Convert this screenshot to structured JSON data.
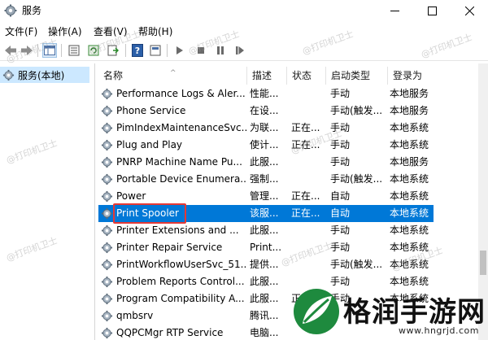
{
  "window": {
    "title": "服务",
    "icon": "gear-icon"
  },
  "menu": [
    {
      "label": "文件(F)"
    },
    {
      "label": "操作(A)"
    },
    {
      "label": "查看(V)"
    },
    {
      "label": "帮助(H)"
    }
  ],
  "tree": {
    "selected_label": "服务(本地)"
  },
  "columns": {
    "name": "名称",
    "desc": "描述",
    "status": "状态",
    "startup": "启动类型",
    "logon": "登录为"
  },
  "services": [
    {
      "name": "Performance Logs & Aler...",
      "desc": "性能...",
      "status": "",
      "startup": "手动",
      "logon": "本地服务"
    },
    {
      "name": "Phone Service",
      "desc": "在设...",
      "status": "",
      "startup": "手动(触发...",
      "logon": "本地服务"
    },
    {
      "name": "PimIndexMaintenanceSvc...",
      "desc": "为联...",
      "status": "正在...",
      "startup": "手动",
      "logon": "本地系统"
    },
    {
      "name": "Plug and Play",
      "desc": "使计...",
      "status": "正在...",
      "startup": "手动",
      "logon": "本地系统"
    },
    {
      "name": "PNRP Machine Name Pu...",
      "desc": "此服...",
      "status": "",
      "startup": "手动",
      "logon": "本地服务"
    },
    {
      "name": "Portable Device Enumera...",
      "desc": "强制...",
      "status": "",
      "startup": "手动(触发...",
      "logon": "本地系统"
    },
    {
      "name": "Power",
      "desc": "管理...",
      "status": "正在...",
      "startup": "自动",
      "logon": "本地系统"
    },
    {
      "name": "Print Spooler",
      "desc": "该服...",
      "status": "正在...",
      "startup": "自动",
      "logon": "本地系统",
      "selected": true
    },
    {
      "name": "Printer Extensions and ...",
      "desc": "此服...",
      "status": "",
      "startup": "手动",
      "logon": "本地系统"
    },
    {
      "name": "Printer Repair Service",
      "desc": "Print...",
      "status": "",
      "startup": "手动",
      "logon": "本地系统"
    },
    {
      "name": "PrintWorkflowUserSvc_51...",
      "desc": "提供...",
      "status": "",
      "startup": "手动(触发...",
      "logon": "本地系统"
    },
    {
      "name": "Problem Reports Control...",
      "desc": "此服...",
      "status": "",
      "startup": "手动",
      "logon": "本地系统"
    },
    {
      "name": "Program Compatibility A...",
      "desc": "此服...",
      "status": "正在...",
      "startup": "手动",
      "logon": "本地系统"
    },
    {
      "name": "qmbsrv",
      "desc": "腾讯...",
      "status": "",
      "startup": "",
      "logon": ""
    },
    {
      "name": "QQPCMgr RTP Service",
      "desc": "电脑...",
      "status": "",
      "startup": "",
      "logon": ""
    }
  ],
  "watermark": "@打印机卫士",
  "brand": {
    "name": "格润手游网",
    "url": "www.hngrjd.com"
  },
  "colors": {
    "selection": "#0078d7",
    "highlight_box": "#e53935",
    "tree_selected": "#cce8ff"
  }
}
